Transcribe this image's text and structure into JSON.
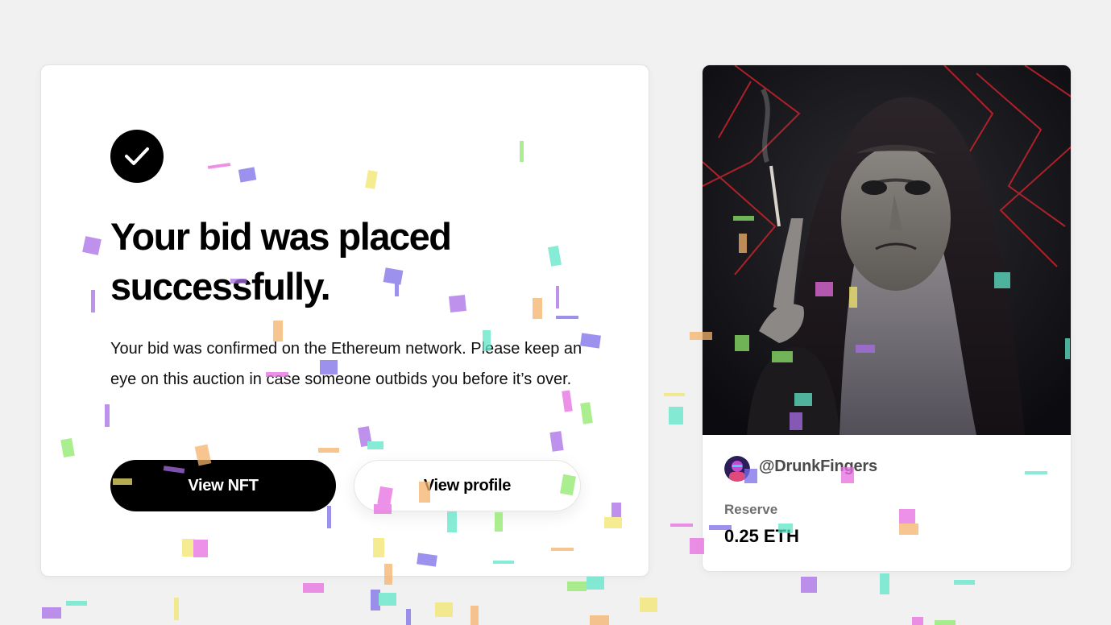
{
  "confirmation": {
    "icon": "check-icon",
    "title": "Your bid was placed successfully.",
    "message": "Your bid was confirmed on the Ethereum network. Please keep an eye on this auction in case someone outbids you before it’s over.",
    "primary_button": "View NFT",
    "secondary_button": "View profile"
  },
  "nft": {
    "artwork": "hooded-witch-artwork",
    "creator_avatar": "creator-avatar",
    "creator_handle": "@DrunkFingers",
    "reserve_label": "Reserve",
    "reserve_value": "0.25 ETH"
  },
  "colors": {
    "page_background": "#f1f1f1",
    "card_background": "#ffffff",
    "primary": "#000000",
    "muted_text": "#6e6e6e",
    "confetti": [
      "#7b6ee8",
      "#e76de0",
      "#f2e56b",
      "#5fe6c8",
      "#8fe86b",
      "#f5b36b",
      "#a86ee6"
    ]
  }
}
